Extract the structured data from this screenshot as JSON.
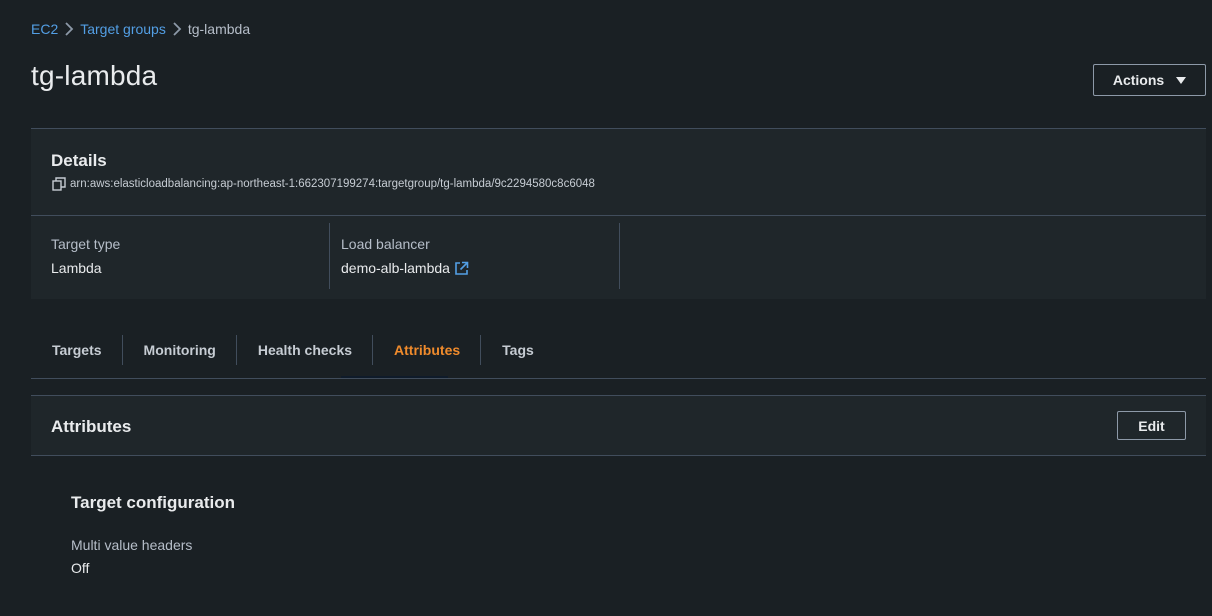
{
  "breadcrumb": {
    "items": [
      "EC2",
      "Target groups"
    ],
    "current": "tg-lambda"
  },
  "page": {
    "title": "tg-lambda",
    "actions_label": "Actions"
  },
  "details": {
    "title": "Details",
    "arn": "arn:aws:elasticloadbalancing:ap-northeast-1:662307199274:targetgroup/tg-lambda/9c2294580c8c6048",
    "target_type_label": "Target type",
    "target_type_value": "Lambda",
    "load_balancer_label": "Load balancer",
    "load_balancer_value": "demo-alb-lambda"
  },
  "tabs": [
    {
      "label": "Targets"
    },
    {
      "label": "Monitoring"
    },
    {
      "label": "Health checks"
    },
    {
      "label": "Attributes",
      "active": true
    },
    {
      "label": "Tags"
    }
  ],
  "attributes": {
    "title": "Attributes",
    "edit_label": "Edit",
    "section_title": "Target configuration",
    "field_label": "Multi value headers",
    "field_value": "Off"
  },
  "colors": {
    "background": "#1a2024",
    "panel": "#1f262a",
    "link": "#539fe5",
    "active_tab": "#f08b2c"
  }
}
